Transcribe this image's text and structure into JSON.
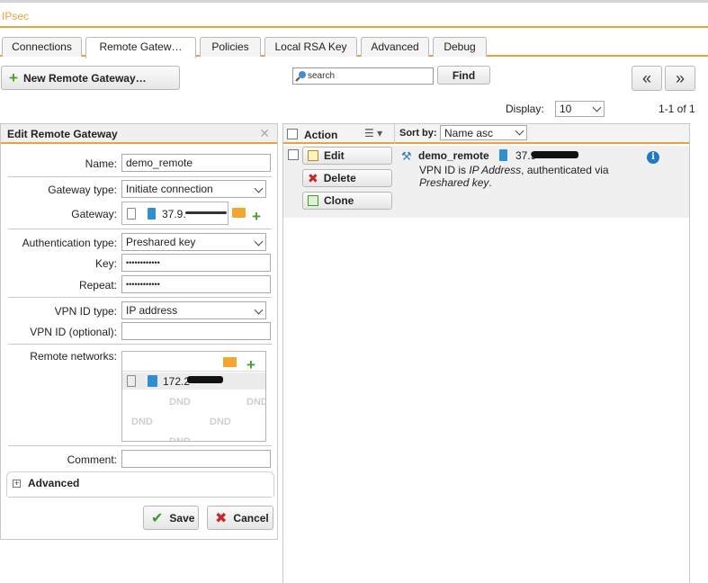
{
  "app": {
    "title": "IPsec"
  },
  "tabs": [
    {
      "label": "Connections"
    },
    {
      "label": "Remote Gatew…"
    },
    {
      "label": "Policies"
    },
    {
      "label": "Local RSA Key"
    },
    {
      "label": "Advanced"
    },
    {
      "label": "Debug"
    }
  ],
  "toolbar": {
    "new_button": "New Remote Gateway…",
    "search_placeholder": "search",
    "find_button": "Find",
    "prev": "«",
    "next": "»",
    "display_label": "Display:",
    "display_value": "10",
    "range": "1-1 of 1"
  },
  "edit_panel": {
    "title": "Edit Remote Gateway",
    "close": "✕",
    "name_label": "Name:",
    "name_value": "demo_remote",
    "gateway_type_label": "Gateway type:",
    "gateway_type_value": "Initiate connection",
    "gateway_label": "Gateway:",
    "gateway_value": "37.9.",
    "auth_type_label": "Authentication type:",
    "auth_type_value": "Preshared key",
    "key_label": "Key:",
    "key_value": "••••••••••••",
    "repeat_label": "Repeat:",
    "repeat_value": "••••••••••••",
    "vpn_id_type_label": "VPN ID type:",
    "vpn_id_type_value": "IP address",
    "vpn_id_label": "VPN ID (optional):",
    "vpn_id_value": "",
    "remote_networks_label": "Remote networks:",
    "remote_network_value": "172.2",
    "dnd": "DND",
    "comment_label": "Comment:",
    "comment_value": "",
    "advanced_label": "Advanced",
    "save": "Save",
    "cancel": "Cancel"
  },
  "list": {
    "action_header": "Action",
    "sort_label": "Sort by:",
    "sort_value": "Name asc",
    "actions": {
      "edit": "Edit",
      "delete": "Delete",
      "clone": "Clone"
    },
    "item": {
      "name": "demo_remote",
      "ip": "37.9",
      "desc_prefix": "VPN ID is ",
      "desc_vpn": "IP Address",
      "desc_middle": ", authenticated via",
      "desc_auth": "Preshared key",
      "desc_end": "."
    }
  },
  "colors": {
    "accent": "#e8a33d",
    "plus_green": "#4c9c2e",
    "delete_red": "#c62828",
    "info_blue": "#1f78c8"
  }
}
